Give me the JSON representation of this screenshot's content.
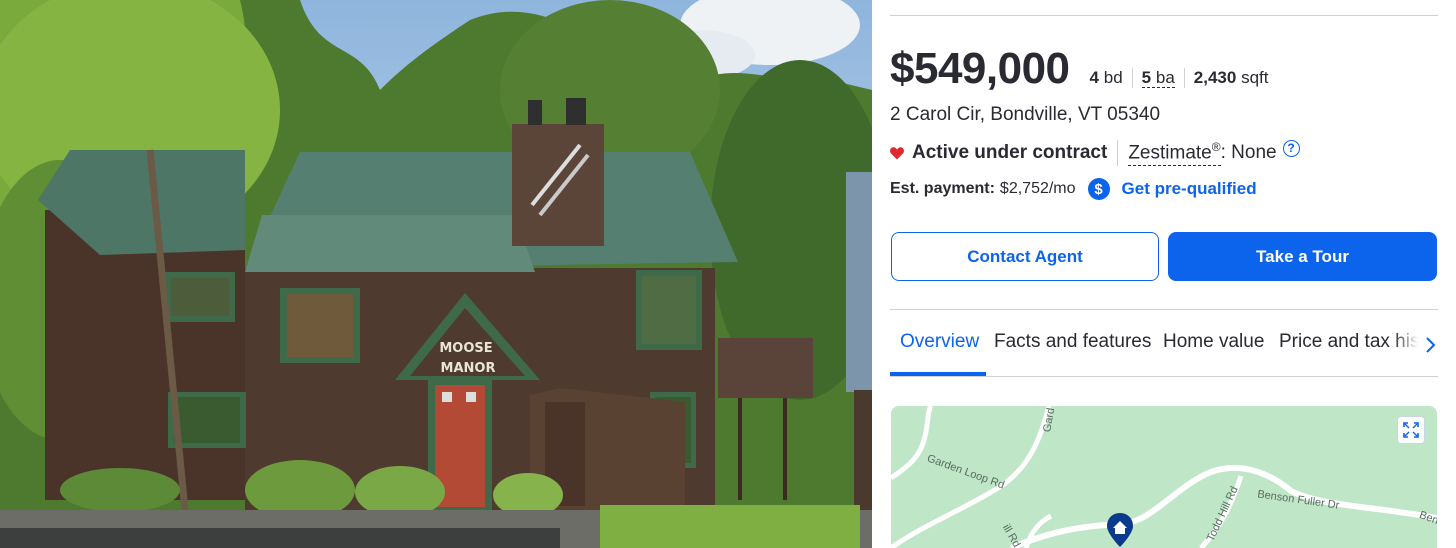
{
  "listing": {
    "price": "$549,000",
    "beds": "4",
    "beds_unit": "bd",
    "baths": "5",
    "baths_unit": "ba",
    "sqft": "2,430",
    "sqft_unit": "sqft",
    "address": "2 Carol Cir, Bondville, VT 05340",
    "status": "Active under contract",
    "zestimate_label": "Zestimate",
    "zestimate_reg": "®",
    "zestimate_value": ": None",
    "help_glyph": "?",
    "payment_label": "Est. payment:",
    "payment_value": "$2,752/mo",
    "dollar_glyph": "$",
    "prequalify_label": "Get pre-qualified"
  },
  "photo": {
    "sign_line1": "MOOSE",
    "sign_line2": "MANOR"
  },
  "actions": {
    "contact_label": "Contact Agent",
    "tour_label": "Take a Tour"
  },
  "tabs": [
    {
      "label": "Overview",
      "active": true
    },
    {
      "label": "Facts and features",
      "active": false
    },
    {
      "label": "Home value",
      "active": false
    },
    {
      "label": "Price and tax history",
      "active": false
    }
  ],
  "map": {
    "roads": [
      "Garden Loop Rd",
      "Benson Fuller Dr",
      "Todd Hill Rd",
      "Gard",
      "ill Rd",
      "Ben"
    ]
  },
  "colors": {
    "accent": "#0d64ec",
    "text": "#2a2a33",
    "status_heart": "#e0282f",
    "map_green": "#bfe6c7"
  },
  "icons": [
    "heart-icon",
    "help-icon",
    "dollar-icon",
    "chevron-right-icon",
    "expand-icon",
    "home-pin-icon"
  ]
}
